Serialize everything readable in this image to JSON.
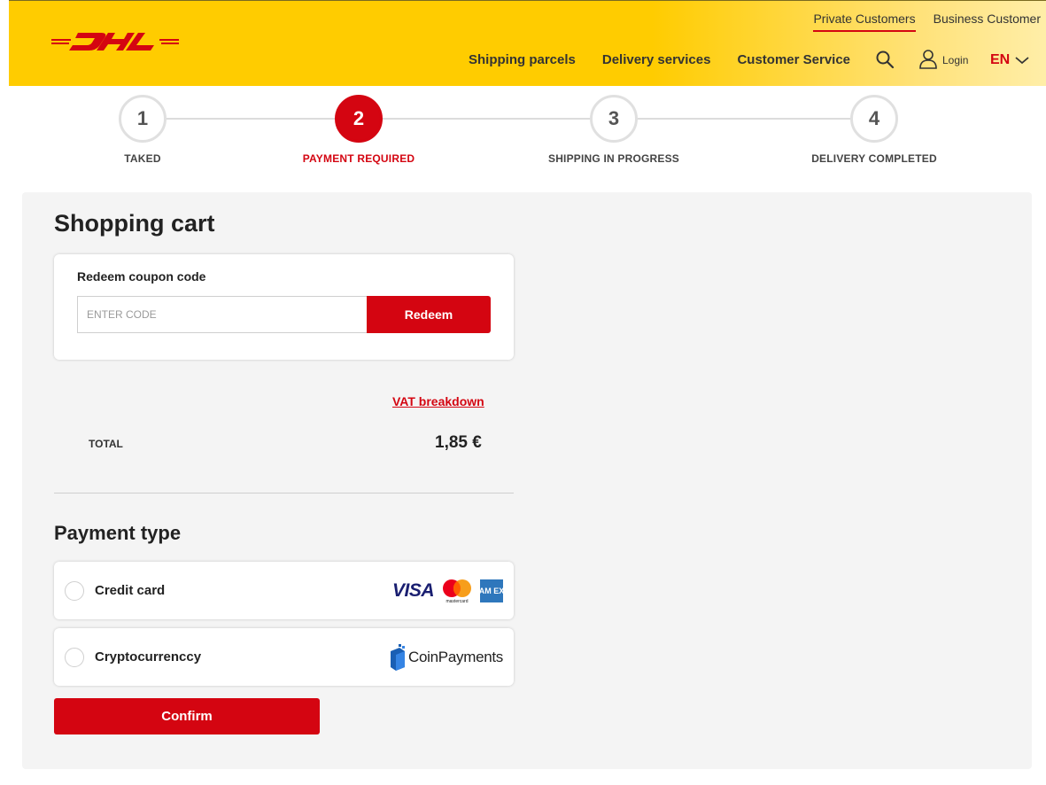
{
  "brand": {
    "logo_icon": "dhl-logo",
    "accent_color": "#d40511",
    "header_color": "#ffcc00"
  },
  "header": {
    "top_links": [
      {
        "label": "Private Customers",
        "active": true
      },
      {
        "label": "Business Customer",
        "active": false
      }
    ],
    "nav": [
      {
        "label": "Shipping parcels"
      },
      {
        "label": "Delivery services"
      },
      {
        "label": "Customer Service"
      }
    ],
    "search_icon": "search-icon",
    "login_label": "Login",
    "language": "EN"
  },
  "steps": [
    {
      "number": "1",
      "label": "TAKED",
      "active": false
    },
    {
      "number": "2",
      "label": "PAYMENT REQUIRED",
      "active": true
    },
    {
      "number": "3",
      "label": "SHIPPING IN PROGRESS",
      "active": false
    },
    {
      "number": "4",
      "label": "DELIVERY COMPLETED",
      "active": false
    }
  ],
  "cart": {
    "title": "Shopping cart",
    "coupon": {
      "label": "Redeem coupon code",
      "placeholder": "ENTER CODE",
      "value": "",
      "button": "Redeem"
    },
    "vat_link": "VAT breakdown",
    "total_label": "TOTAL",
    "total_value": "1,85 €"
  },
  "payment": {
    "title": "Payment type",
    "options": [
      {
        "label": "Credit card",
        "logos": [
          "visa-logo",
          "mastercard-logo",
          "amex-logo"
        ],
        "visa_text": "VISA",
        "mastercard_text": "mastercard",
        "amex_text": "AM EX"
      },
      {
        "label": "Cryptocurrenccy",
        "logo": "coinpayments-logo",
        "logo_text": "CoinPayments"
      }
    ],
    "confirm_button": "Confirm"
  }
}
